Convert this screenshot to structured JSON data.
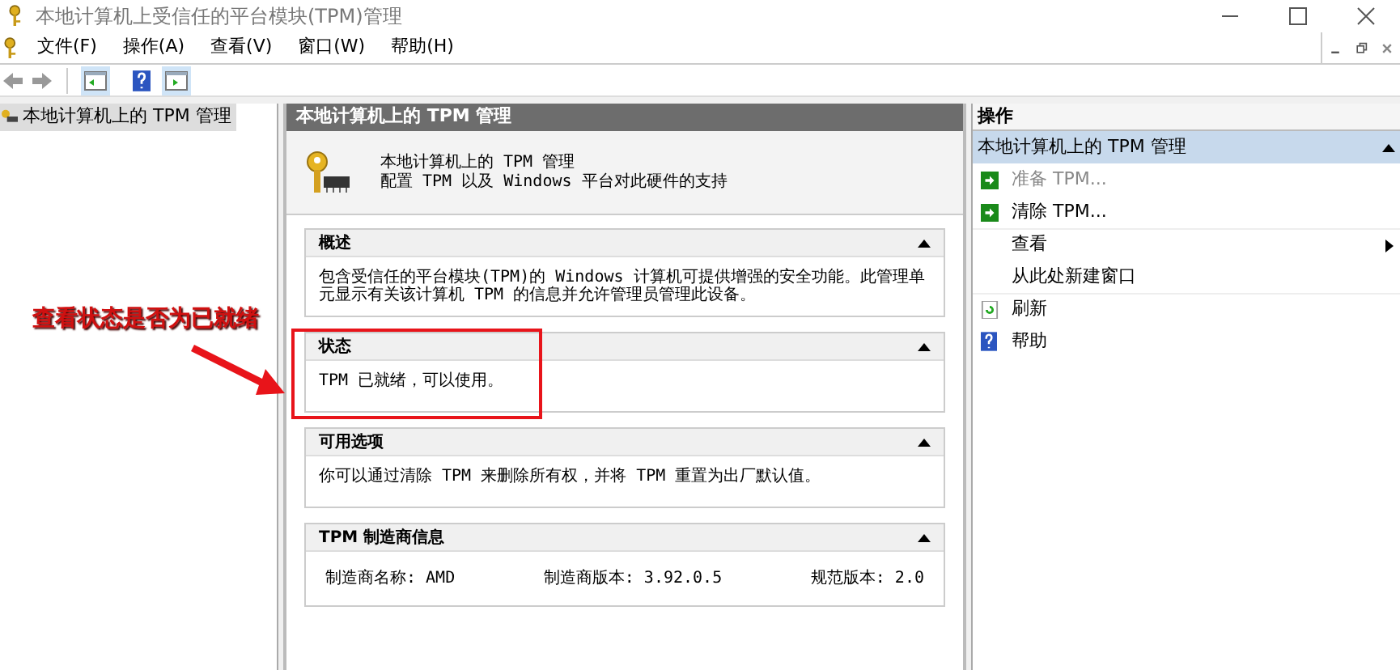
{
  "window": {
    "title": "本地计算机上受信任的平台模块(TPM)管理"
  },
  "menu": [
    "文件(F)",
    "操作(A)",
    "查看(V)",
    "窗口(W)",
    "帮助(H)"
  ],
  "tree": {
    "items": [
      {
        "label": "本地计算机上的 TPM 管理",
        "selected": true
      }
    ]
  },
  "center": {
    "header": "本地计算机上的 TPM 管理",
    "title": "本地计算机上的 TPM 管理",
    "subtitle": "配置 TPM 以及 Windows 平台对此硬件的支持",
    "sections": [
      {
        "title": "概述",
        "expanded": true,
        "kind": "text",
        "text": "包含受信任的平台模块(TPM)的 Windows 计算机可提供增强的安全功能。此管理单元显示有关该计算机 TPM 的信息并允许管理员管理此设备。"
      },
      {
        "title": "状态",
        "expanded": true,
        "kind": "text",
        "text": "TPM 已就绪，可以使用。"
      },
      {
        "title": "可用选项",
        "expanded": true,
        "kind": "text",
        "text": "你可以通过清除 TPM 来删除所有权，并将 TPM 重置为出厂默认值。"
      },
      {
        "title": "TPM 制造商信息",
        "expanded": true,
        "kind": "fields",
        "fields": [
          "制造商名称: AMD",
          "制造商版本: 3.92.0.5",
          "规范版本: 2.0"
        ]
      }
    ]
  },
  "actions": {
    "header": "操作",
    "group": "本地计算机上的 TPM 管理",
    "items": [
      {
        "label": "准备 TPM...",
        "kind": "arrow",
        "disabled": true
      },
      {
        "label": "清除 TPM...",
        "kind": "arrow",
        "disabled": false
      },
      {
        "label": "查看",
        "kind": "submenu",
        "disabled": false
      },
      {
        "label": "从此处新建窗口",
        "kind": "plain",
        "disabled": false
      },
      {
        "label": "刷新",
        "kind": "refresh",
        "disabled": false
      },
      {
        "label": "帮助",
        "kind": "help",
        "disabled": false
      }
    ]
  },
  "annotation": {
    "text": "查看状态是否为已就绪"
  }
}
